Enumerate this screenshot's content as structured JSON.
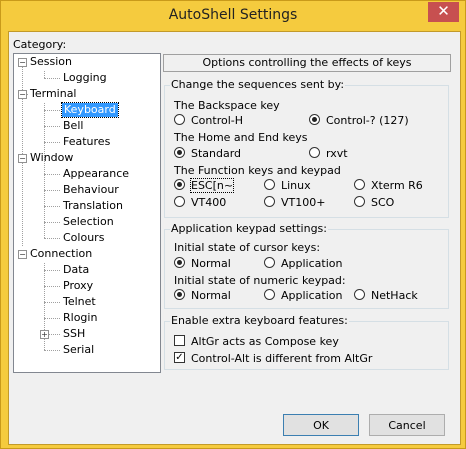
{
  "window": {
    "title": "AutoShell Settings",
    "close_symbol": "✕"
  },
  "category_label": "Category:",
  "tree": [
    {
      "label": "Session"
    },
    {
      "label": "Logging"
    },
    {
      "label": "Terminal"
    },
    {
      "label": "Keyboard",
      "selected": true
    },
    {
      "label": "Bell"
    },
    {
      "label": "Features"
    },
    {
      "label": "Window"
    },
    {
      "label": "Appearance"
    },
    {
      "label": "Behaviour"
    },
    {
      "label": "Translation"
    },
    {
      "label": "Selection"
    },
    {
      "label": "Colours"
    },
    {
      "label": "Connection"
    },
    {
      "label": "Data"
    },
    {
      "label": "Proxy"
    },
    {
      "label": "Telnet"
    },
    {
      "label": "Rlogin"
    },
    {
      "label": "SSH"
    },
    {
      "label": "Serial"
    }
  ],
  "tree_expanders": {
    "collapse": "−",
    "expand": "+"
  },
  "panel_header": "Options controlling the effects of keys",
  "seq_group": {
    "title": "Change the sequences sent by:",
    "backspace": {
      "label": "The Backspace key",
      "options": [
        "Control-H",
        "Control-? (127)"
      ],
      "selected": 1
    },
    "homeend": {
      "label": "The Home and End keys",
      "options": [
        "Standard",
        "rxvt"
      ],
      "selected": 0
    },
    "funckeys": {
      "label": "The Function keys and keypad",
      "options": [
        "ESC[n~",
        "Linux",
        "Xterm R6",
        "VT400",
        "VT100+",
        "SCO"
      ],
      "selected": 0
    }
  },
  "keypad_group": {
    "title": "Application keypad settings:",
    "cursor": {
      "label": "Initial state of cursor keys:",
      "options": [
        "Normal",
        "Application"
      ],
      "selected": 0
    },
    "numeric": {
      "label": "Initial state of numeric keypad:",
      "options": [
        "Normal",
        "Application",
        "NetHack"
      ],
      "selected": 0
    }
  },
  "extra_group": {
    "title": "Enable extra keyboard features:",
    "altgr_compose": {
      "label": "AltGr acts as Compose key",
      "checked": false
    },
    "ctrl_alt": {
      "label": "Control-Alt is different from AltGr",
      "checked": true
    }
  },
  "check_mark": "✓",
  "buttons": {
    "ok": "OK",
    "cancel": "Cancel"
  }
}
